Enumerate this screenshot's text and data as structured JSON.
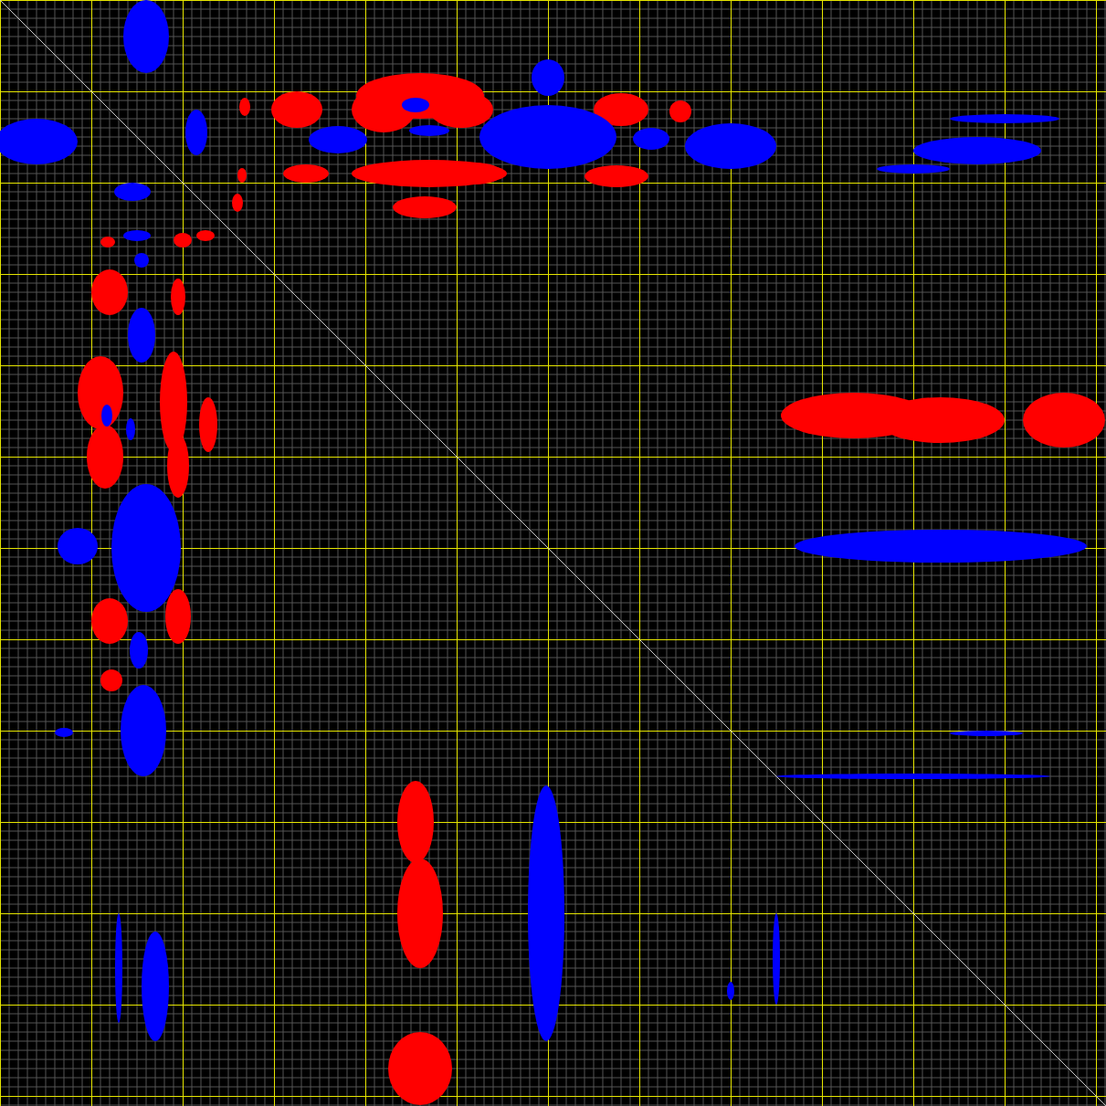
{
  "spectrum": {
    "grid": true,
    "diagonal": true
  }
}
